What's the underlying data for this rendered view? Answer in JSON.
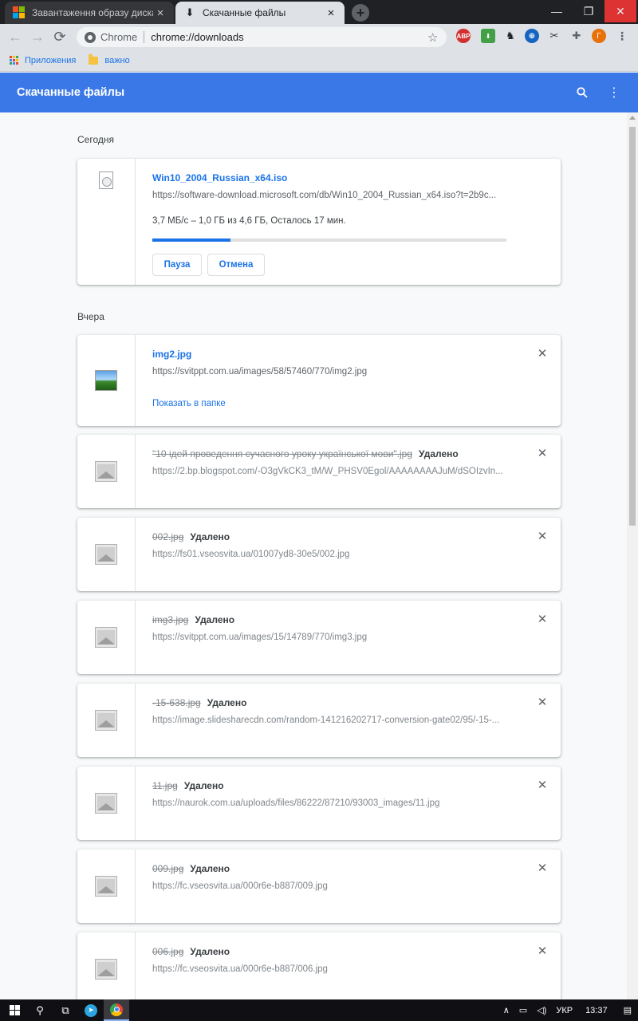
{
  "tabs": [
    {
      "title": "Завантаження образу диска Wi",
      "active": false
    },
    {
      "title": "Скачанные файлы",
      "active": true
    }
  ],
  "omnibox": {
    "chip": "Chrome",
    "url": "chrome://downloads"
  },
  "extensions": [
    "abp-icon",
    "download-ext-icon",
    "tree-ext-icon",
    "globe-ext-icon",
    "tools-ext-icon",
    "puzzle-icon",
    "profile-avatar"
  ],
  "profile_initial": "Г",
  "bookmarks": [
    {
      "label": "Приложения",
      "icon": "apps-icon"
    },
    {
      "label": "важно",
      "icon": "folder-icon"
    }
  ],
  "header": {
    "title": "Скачанные файлы"
  },
  "sections": {
    "today": "Сегодня",
    "yesterday": "Вчера"
  },
  "active_download": {
    "name": "Win10_2004_Russian_x64.iso",
    "url": "https://software-download.microsoft.com/db/Win10_2004_Russian_x64.iso?t=2b9c...",
    "progress_text": "3,7 МБ/с – 1,0 ГБ из 4,6 ГБ, Осталось 17 мин.",
    "progress": 0.22,
    "pause_label": "Пауза",
    "cancel_label": "Отмена"
  },
  "completed_download": {
    "name": "img2.jpg",
    "url": "https://svitppt.com.ua/images/58/57460/770/img2.jpg",
    "show_label": "Показать в папке"
  },
  "deleted_status": "Удалено",
  "deleted_downloads": [
    {
      "name": "\"10 ідей проведення сучасного уроку української мови\".jpg",
      "url": "https://2.bp.blogspot.com/-O3gVkCK3_tM/W_PHSV0Egol/AAAAAAAAJuM/dSOIzvIn..."
    },
    {
      "name": "002.jpg",
      "url": "https://fs01.vseosvita.ua/01007yd8-30e5/002.jpg"
    },
    {
      "name": "img3.jpg",
      "url": "https://svitppt.com.ua/images/15/14789/770/img3.jpg"
    },
    {
      "name": "-15-638.jpg",
      "url": "https://image.slidesharecdn.com/random-141216202717-conversion-gate02/95/-15-..."
    },
    {
      "name": "11.jpg",
      "url": "https://naurok.com.ua/uploads/files/86222/87210/93003_images/11.jpg"
    },
    {
      "name": "009.jpg",
      "url": "https://fc.vseosvita.ua/000r6e-b887/009.jpg"
    },
    {
      "name": "006.jpg",
      "url": "https://fc.vseosvita.ua/000r6e-b887/006.jpg"
    }
  ],
  "taskbar": {
    "language": "УКР",
    "time": "13:37"
  },
  "colors": {
    "accent": "#1a73e8",
    "header": "#3b78e7"
  }
}
